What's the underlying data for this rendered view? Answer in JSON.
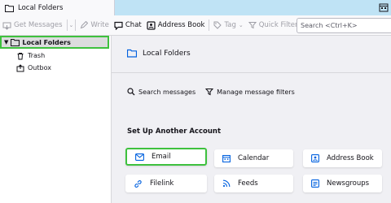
{
  "tab": {
    "title": "Local Folders"
  },
  "toolbar": {
    "get_messages": "Get Messages",
    "write": "Write",
    "chat": "Chat",
    "address_book": "Address Book",
    "tag": "Tag",
    "quick_filter": "Quick Filter",
    "search_placeholder": "Search <Ctrl+K>"
  },
  "folders": {
    "root": "Local Folders",
    "children": [
      "Trash",
      "Outbox"
    ]
  },
  "main": {
    "title": "Local Folders",
    "search_messages": "Search messages",
    "manage_filters": "Manage message filters",
    "setup_title": "Set Up Another Account",
    "cards": [
      "Email",
      "Calendar",
      "Address Book",
      "Filelink",
      "Feeds",
      "Newsgroups"
    ]
  },
  "colors": {
    "accent": "#0060df",
    "highlight": "#3ec13e",
    "titlebar": "#bfe3f5"
  }
}
